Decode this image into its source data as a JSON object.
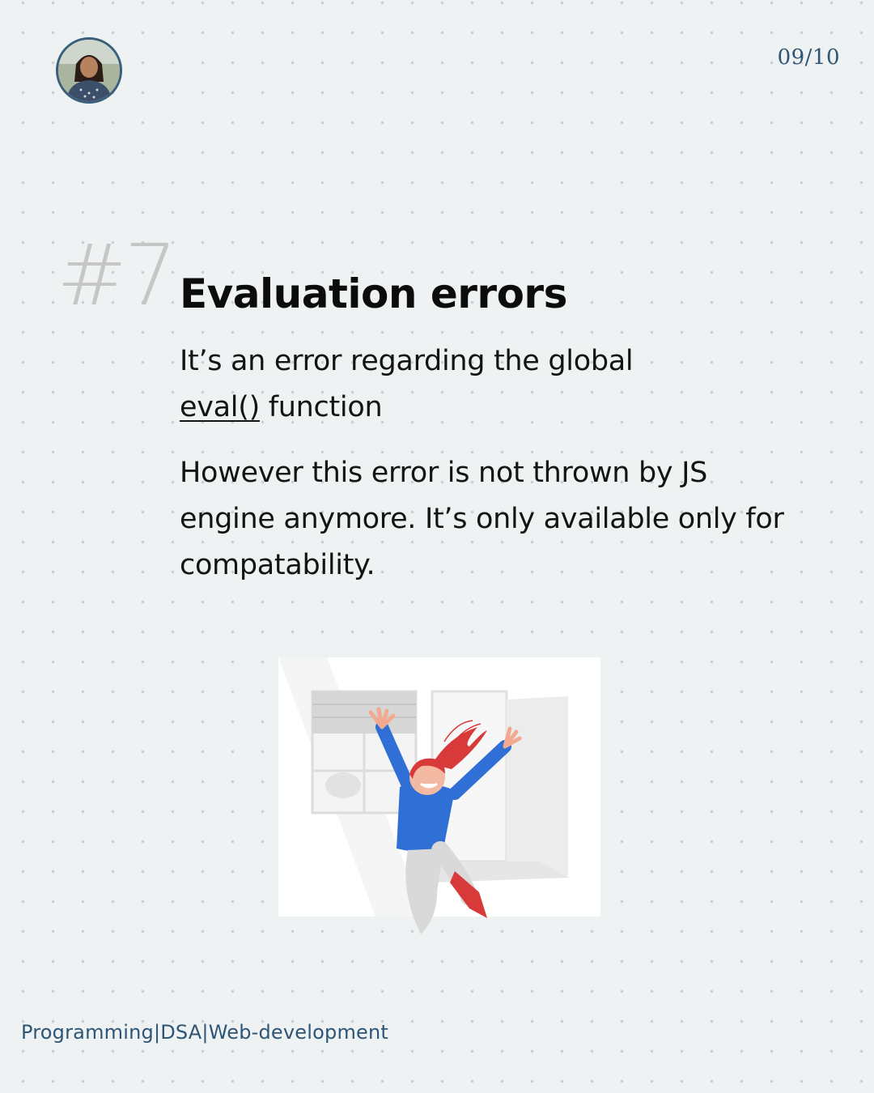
{
  "header": {
    "page_counter": "09/10"
  },
  "slide": {
    "number": "#7",
    "title": "Evaluation errors",
    "intro_before": "It’s an error regarding the global",
    "intro_code": "eval()",
    "intro_after": " function",
    "detail": "However this error is not thrown by JS engine anymore. It’s only available only for compatability."
  },
  "footer": {
    "tagline": "Programming|DSA|Web-development"
  },
  "colors": {
    "background": "#eef2f3",
    "accent": "#2e5575",
    "title": "#0c0c0c",
    "number_mark": "#c6c6c6"
  }
}
